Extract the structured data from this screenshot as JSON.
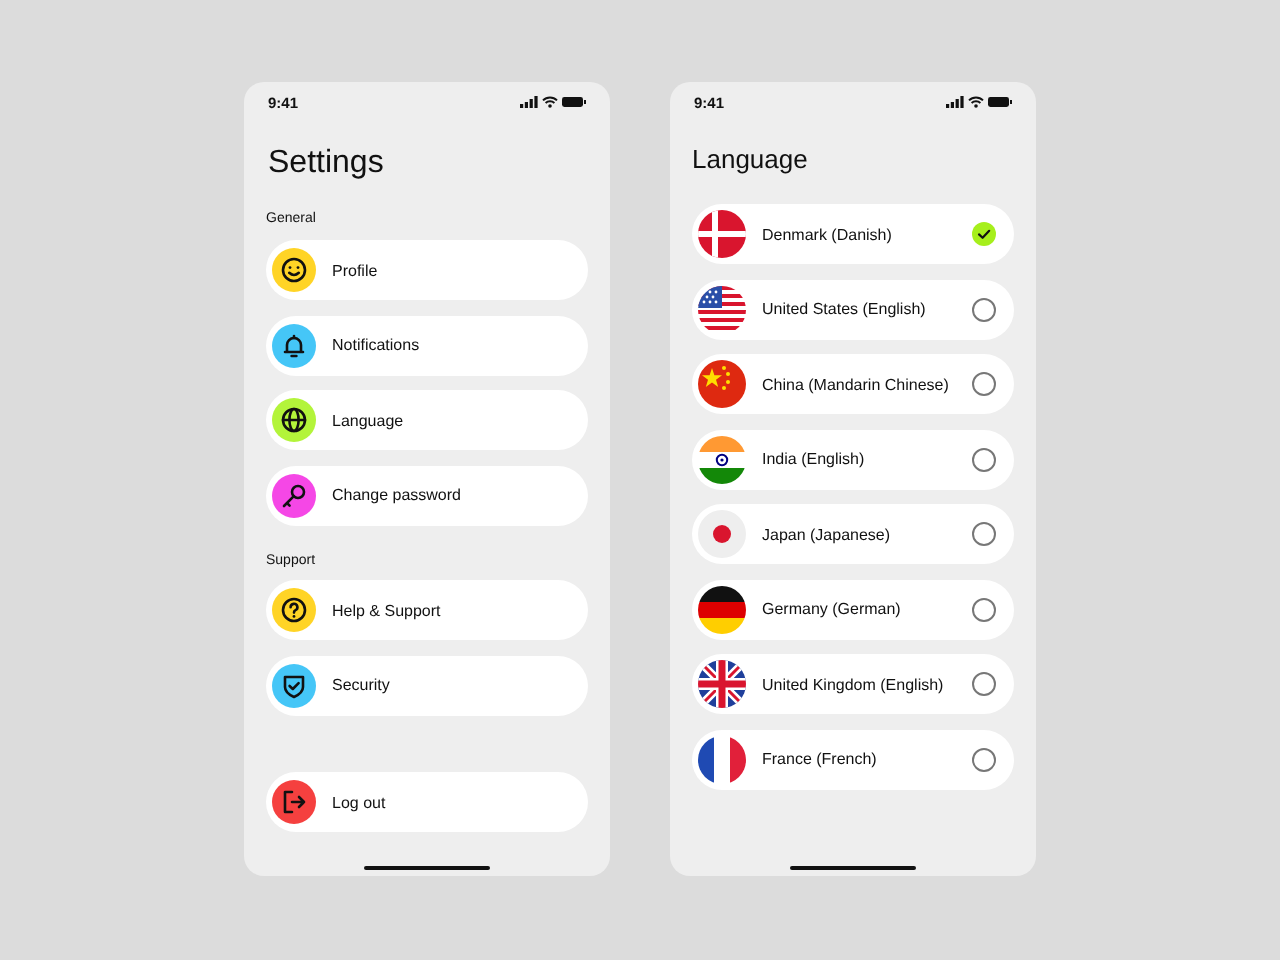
{
  "settings_screen": {
    "status_bar": {
      "time": "9:41"
    },
    "title": "Settings",
    "sections": [
      {
        "label": "General",
        "items": [
          {
            "label": "Profile",
            "color": "#ffd426"
          },
          {
            "label": "Notifications",
            "color": "#45c6f7"
          },
          {
            "label": "Language",
            "color": "#b3f43a"
          },
          {
            "label": "Change password",
            "color": "#f547e6"
          }
        ]
      },
      {
        "label": "Support",
        "items": [
          {
            "label": "Help & Support",
            "color": "#ffd426"
          },
          {
            "label": "Security",
            "color": "#45c6f7"
          }
        ]
      }
    ],
    "logout": {
      "label": "Log out",
      "color": "#f5403f"
    }
  },
  "language_screen": {
    "status_bar": {
      "time": "9:41"
    },
    "title": "Language",
    "languages": [
      {
        "label": "Denmark (Danish)",
        "selected": true
      },
      {
        "label": "United States (English)",
        "selected": false
      },
      {
        "label": "China (Mandarin Chinese)",
        "selected": false
      },
      {
        "label": "India (English)",
        "selected": false
      },
      {
        "label": "Japan (Japanese)",
        "selected": false
      },
      {
        "label": "Germany (German)",
        "selected": false
      },
      {
        "label": "United Kingdom (English)",
        "selected": false
      },
      {
        "label": "France (French)",
        "selected": false
      }
    ]
  }
}
